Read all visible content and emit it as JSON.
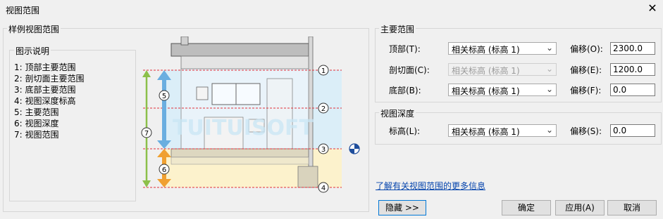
{
  "window": {
    "title": "视图范围"
  },
  "sample": {
    "group_label": "样例视图范围",
    "legend_title": "图示说明",
    "legend_items": [
      "1: 顶部主要范围",
      "2: 剖切面主要范围",
      "3: 底部主要范围",
      "4: 视图深度标高",
      "5: 主要范围",
      "6: 视图深度",
      "7: 视图范围"
    ],
    "diagram": {
      "callouts": [
        "1",
        "2",
        "3",
        "4",
        "5",
        "6",
        "7"
      ],
      "watermark": "TUITUISOFT"
    }
  },
  "primary_range": {
    "group_label": "主要范围",
    "rows": [
      {
        "label": "顶部(T):",
        "level": "相关标高 (标高 1)",
        "offset_label": "偏移(O):",
        "offset": "2300.0",
        "disabled": false
      },
      {
        "label": "剖切面(C):",
        "level": "相关标高 (标高 1)",
        "offset_label": "偏移(E):",
        "offset": "1200.0",
        "disabled": true
      },
      {
        "label": "底部(B):",
        "level": "相关标高 (标高 1)",
        "offset_label": "偏移(F):",
        "offset": "0.0",
        "disabled": false
      }
    ]
  },
  "view_depth": {
    "group_label": "视图深度",
    "label": "标高(L):",
    "level": "相关标高 (标高 1)",
    "offset_label": "偏移(S):",
    "offset": "0.0"
  },
  "link_text": "了解有关视图范围的更多信息",
  "buttons": {
    "hide": "隐藏 >>",
    "ok": "确定",
    "apply": "应用(A)",
    "cancel": "取消"
  },
  "colors": {
    "range_line": "#e0303a",
    "main_range": "#6aaee0",
    "view_depth": "#f0a030",
    "view_range": "#8cc04a",
    "link": "#0645ad",
    "focus_border": "#0078d7"
  }
}
